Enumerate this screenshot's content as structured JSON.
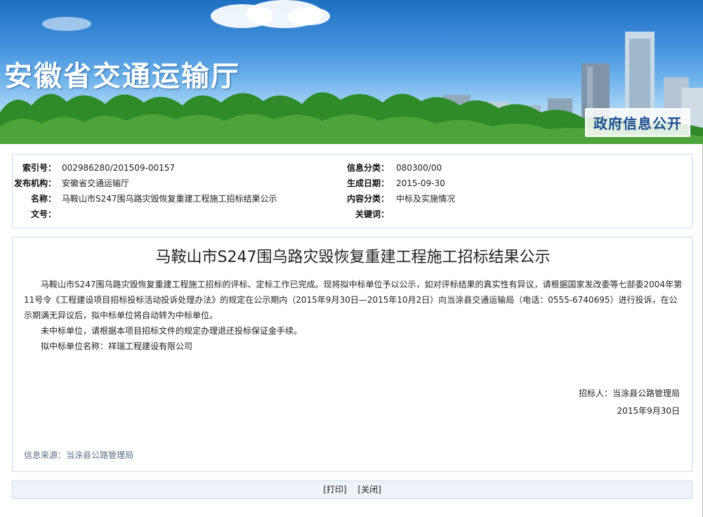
{
  "banner": {
    "site_title": "安徽省交通运输厅",
    "badge": "政府信息公开"
  },
  "meta": {
    "index_label": "索引号：",
    "index_value": "002986280/201509-00157",
    "category_label": "信息分类：",
    "category_value": "080300/00",
    "publisher_label": "发布机构：",
    "publisher_value": "安徽省交通运输厅",
    "date_label": "生成日期：",
    "date_value": "2015-09-30",
    "name_label": "名称：",
    "name_value": "马鞍山市S247围乌路灾毁恢复重建工程施工招标结果公示",
    "content_label": "内容分类：",
    "content_value": "中标及实施情况",
    "docno_label": "文号：",
    "docno_value": "",
    "keyword_label": "关键词：",
    "keyword_value": ""
  },
  "article": {
    "title": "马鞍山市S247围乌路灾毁恢复重建工程施工招标结果公示",
    "paragraph1": "马鞍山市S247围乌路灾毁恢复重建工程施工招标的评标、定标工作已完成。现将拟中标单位予以公示，如对评标结果的真实性有异议，请根据国家发改委等七部委2004年第11号令《工程建设项目招标投标活动投诉处理办法》的规定在公示期内（2015年9月30日—2015年10月2日）向当涂县交通运输局（电话：0555-6740695）进行投诉，在公示期满无异议后，拟中标单位将自动转为中标单位。",
    "paragraph2": "未中标单位，请根据本项目招标文件的规定办理退还投标保证金手续。",
    "paragraph3": "拟中标单位名称：祥瑞工程建设有限公司",
    "signer": "招标人：当涂县公路管理局",
    "sign_date": "2015年9月30日",
    "source": "信息来源：当涂县公路管理局"
  },
  "footer": {
    "print_label": "[打印]",
    "close_label": "[关闭]"
  }
}
